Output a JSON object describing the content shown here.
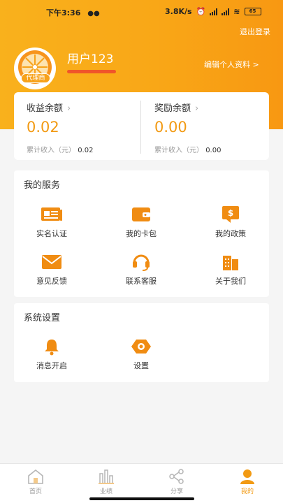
{
  "status_bar": {
    "time": "下午3:36",
    "network_speed": "3.8K/s",
    "battery": "65"
  },
  "header": {
    "logout_label": "退出登录",
    "username": "用户123",
    "edit_profile_label": "编辑个人资料 >",
    "agent_badge": "代理商"
  },
  "balances": [
    {
      "title": "收益余额",
      "amount": "0.02",
      "sub_label": "累计收入（元）",
      "sub_value": "0.02"
    },
    {
      "title": "奖励余额",
      "amount": "0.00",
      "sub_label": "累计收入（元）",
      "sub_value": "0.00"
    }
  ],
  "services": {
    "title": "我的服务",
    "items": [
      {
        "label": "实名认证",
        "icon": "id-card-icon"
      },
      {
        "label": "我的卡包",
        "icon": "wallet-icon"
      },
      {
        "label": "我的政策",
        "icon": "policy-icon"
      },
      {
        "label": "意见反馈",
        "icon": "mail-icon"
      },
      {
        "label": "联系客服",
        "icon": "headset-icon"
      },
      {
        "label": "关于我们",
        "icon": "building-icon"
      }
    ]
  },
  "settings": {
    "title": "系统设置",
    "items": [
      {
        "label": "消息开启",
        "icon": "bell-icon"
      },
      {
        "label": "设置",
        "icon": "gear-icon"
      }
    ]
  },
  "bottom_nav": [
    {
      "label": "首页",
      "icon": "home-icon",
      "active": false
    },
    {
      "label": "业绩",
      "icon": "bar-chart-icon",
      "active": false
    },
    {
      "label": "分享",
      "icon": "share-icon",
      "active": false
    },
    {
      "label": "我的",
      "icon": "user-icon",
      "active": true
    }
  ],
  "colors": {
    "brand_orange": "#f9a717",
    "amount_orange": "#f29a13",
    "icon_orange": "#f08c12"
  }
}
